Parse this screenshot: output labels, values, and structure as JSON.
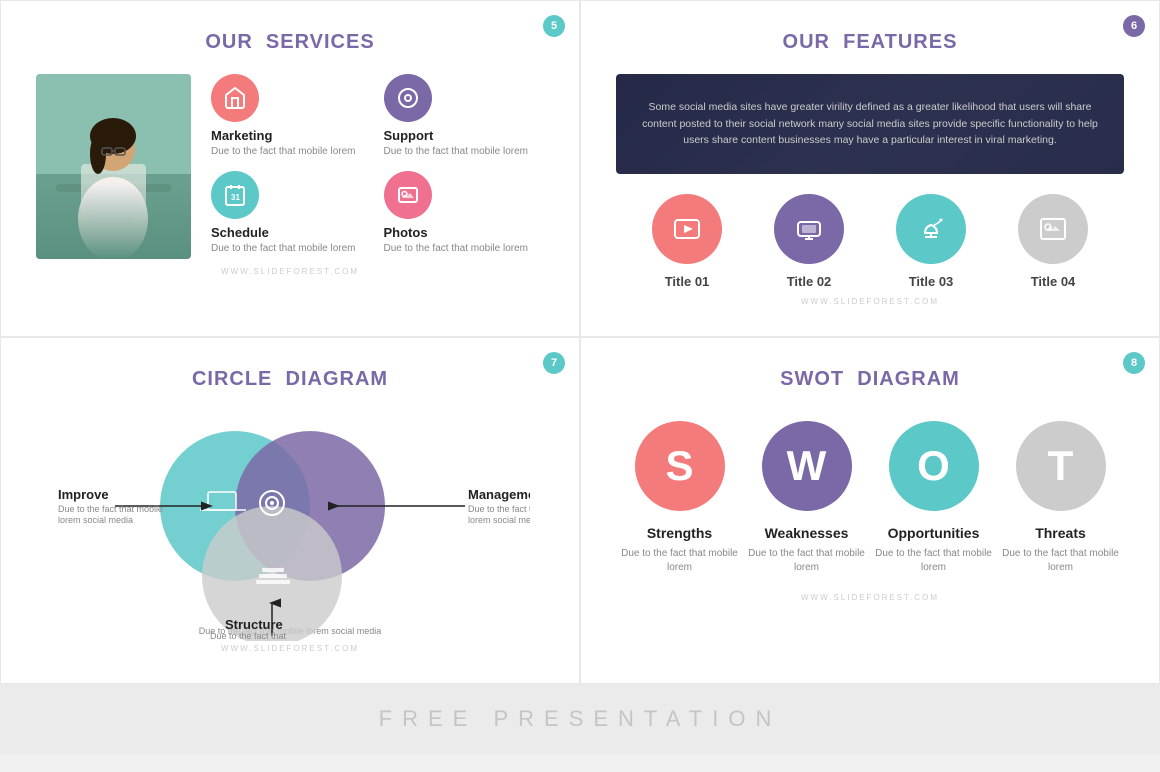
{
  "slides": {
    "slide1": {
      "number": "5",
      "title_plain": "OUR",
      "title_accent": "SERVICES",
      "services": [
        {
          "name": "Marketing",
          "desc": "Due to the fact that mobile lorem",
          "icon": "🏠",
          "color": "icon-salmon"
        },
        {
          "name": "Support",
          "desc": "Due to the fact that mobile lorem",
          "icon": "⚙",
          "color": "icon-purple"
        },
        {
          "name": "Schedule",
          "desc": "Due to the fact that mobile lorem",
          "icon": "📅",
          "color": "icon-teal"
        },
        {
          "name": "Photos",
          "desc": "Due to the fact that mobile lorem",
          "icon": "🖼",
          "color": "icon-pink"
        }
      ],
      "watermark": "WWW.SLIDEFOREST.COM"
    },
    "slide2": {
      "number": "6",
      "title_plain": "OUR",
      "title_accent": "FEATURES",
      "banner_text": "Some social media sites have greater virility defined as a greater likelihood that users will share content posted to their social network many social media sites provide specific functionality to help users share content businesses may have a particular interest in viral marketing.",
      "features": [
        {
          "title": "Title 01",
          "icon": "▶",
          "color": "fi-salmon"
        },
        {
          "title": "Title 02",
          "icon": "⬜",
          "color": "fi-purple"
        },
        {
          "title": "Title 03",
          "icon": "☕",
          "color": "fi-teal"
        },
        {
          "title": "Title 04",
          "icon": "🖼",
          "color": "fi-gray"
        }
      ],
      "watermark": "WWW.SLIDEFOREST.COM"
    },
    "slide3": {
      "number": "7",
      "title_plain": "CIRCLE",
      "title_accent": "DIAGRAM",
      "labels": {
        "improve": "Improve",
        "improve_desc": "Due to the fact that mobile lorem social media",
        "management": "Management",
        "management_desc": "Due to the fact that mobile lorem social media",
        "structure": "Structure",
        "structure_desc": "Due to the fact that mobile lorem social media"
      },
      "watermark": "WWW.SLIDEFOREST.COM"
    },
    "slide4": {
      "number": "8",
      "title_plain": "SWOT",
      "title_accent": "DIAGRAM",
      "items": [
        {
          "letter": "S",
          "title": "Strengths",
          "desc": "Due to the fact that mobile lorem",
          "color": "sw-salmon"
        },
        {
          "letter": "W",
          "title": "Weaknesses",
          "desc": "Due to the fact that mobile lorem",
          "color": "sw-purple"
        },
        {
          "letter": "O",
          "title": "Opportunities",
          "desc": "Due to the fact that mobile lorem",
          "color": "sw-teal"
        },
        {
          "letter": "T",
          "title": "Threats",
          "desc": "Due to the fact that mobile lorem",
          "color": "sw-gray"
        }
      ],
      "watermark": "WWW.SLIDEFOREST.COM"
    },
    "bottom_banner": "FREE   PRESENTATION"
  }
}
